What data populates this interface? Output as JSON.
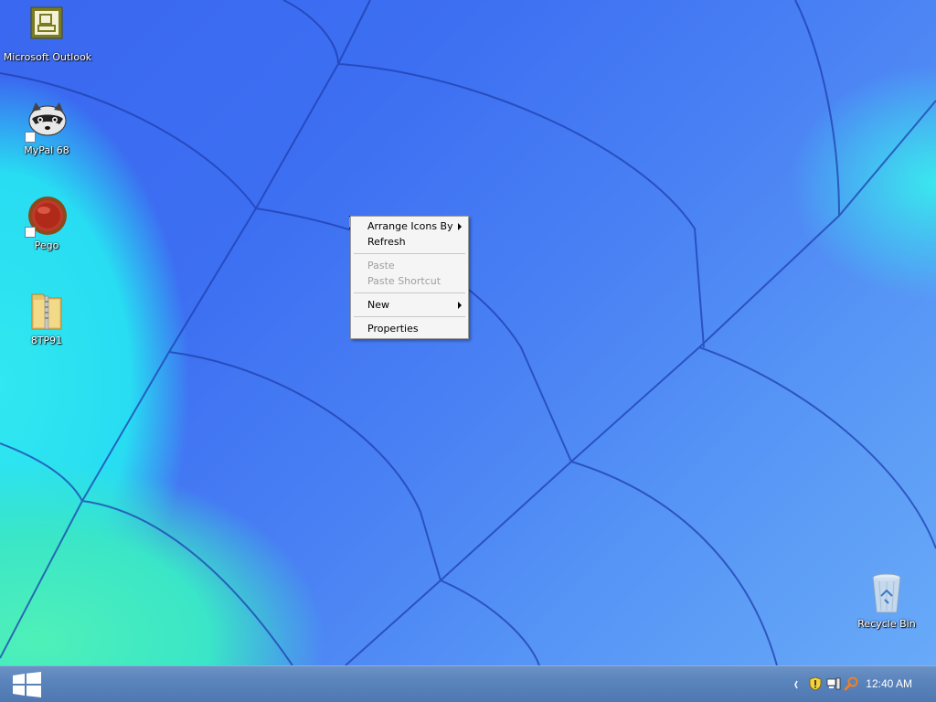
{
  "desktop": {
    "icons": [
      {
        "label": "Microsoft Outlook"
      },
      {
        "label": "MyPal 68"
      },
      {
        "label": "Pego"
      },
      {
        "label": "8TP91"
      },
      {
        "label": "Recycle Bin"
      }
    ]
  },
  "context_menu": {
    "items": [
      {
        "label": "Arrange Icons By",
        "enabled": true,
        "submenu": true
      },
      {
        "label": "Refresh",
        "enabled": true,
        "submenu": false
      },
      {
        "label": "Paste",
        "enabled": false,
        "submenu": false
      },
      {
        "label": "Paste Shortcut",
        "enabled": false,
        "submenu": false
      },
      {
        "label": "New",
        "enabled": true,
        "submenu": true
      },
      {
        "label": "Properties",
        "enabled": true,
        "submenu": false
      }
    ]
  },
  "taskbar": {
    "start_icon": "windows-logo-icon",
    "tray_icons": [
      "tray-overflow-icon",
      "security-shield-icon",
      "network-icon",
      "search-magnifier-icon"
    ],
    "clock": "12:40 AM"
  },
  "colors": {
    "taskbar": "#5a84bc",
    "wallpaper_blue": "#3d6ff2",
    "wallpaper_cyan": "#30e8f0",
    "wallpaper_green": "#4ff0b8",
    "menu_background": "#f5f5f5",
    "menu_disabled_text": "#a0a0a0"
  }
}
